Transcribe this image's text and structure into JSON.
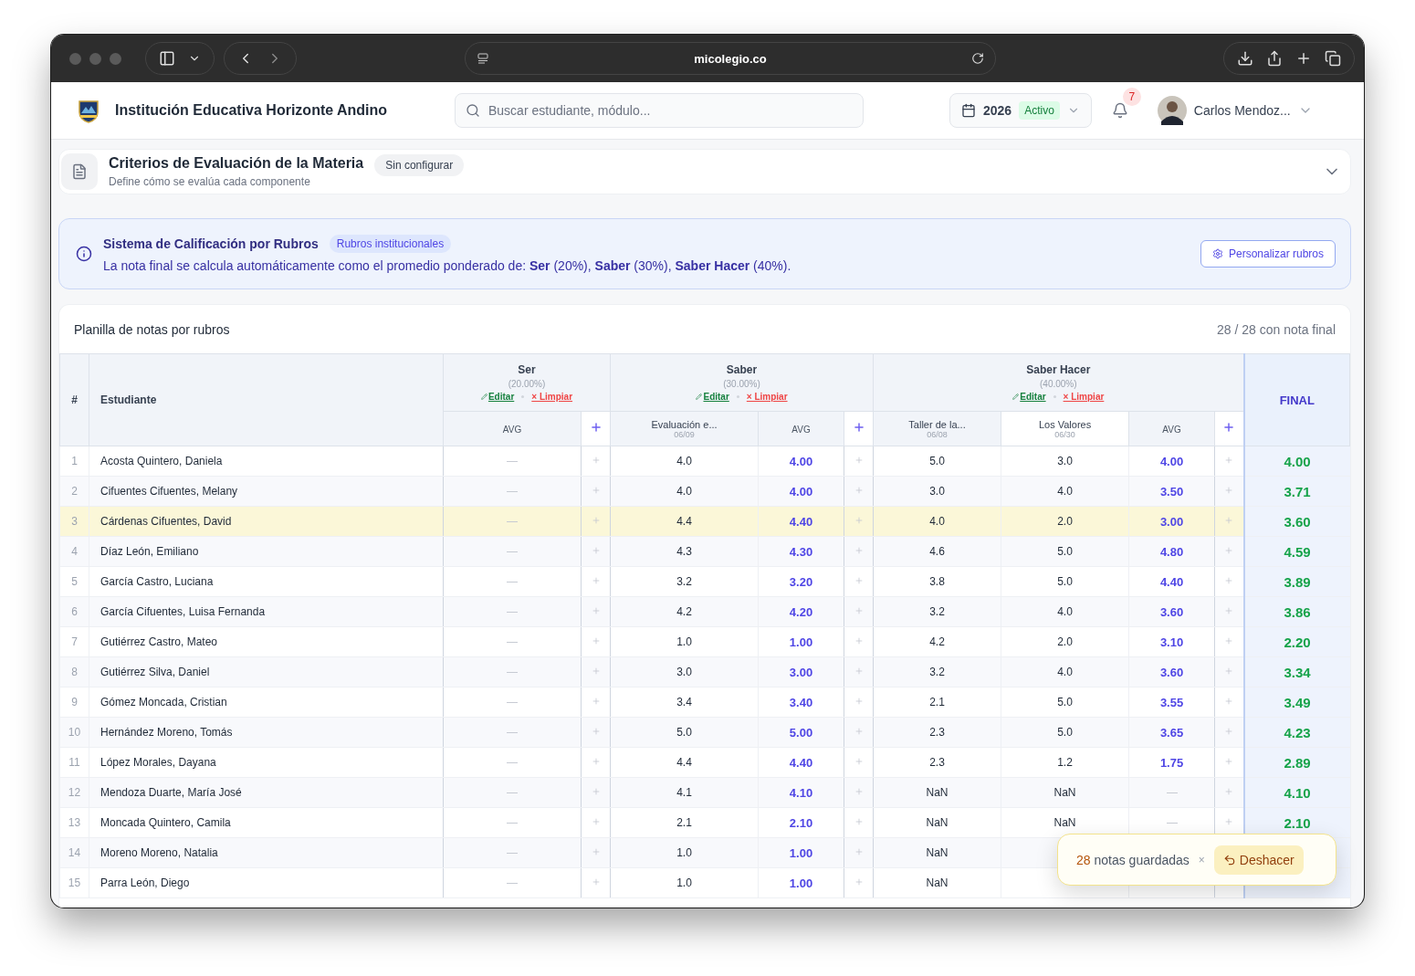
{
  "browser": {
    "address": "micolegio.co"
  },
  "header": {
    "school": "Institución Educativa Horizonte Andino",
    "search": {
      "placeholder": "Buscar estudiante, módulo..."
    },
    "year": "2026",
    "year_status": "Activo",
    "notifications": "7",
    "user": "Carlos Mendoz..."
  },
  "criteria": {
    "title": "Criterios de Evaluación de la Materia",
    "badge": "Sin configurar",
    "subtitle": "Define cómo se evalúa cada componente",
    "expanded": false
  },
  "info": {
    "title": "Sistema de Calificación por Rubros",
    "badge": "Rubros institucionales",
    "text": "La nota final se calcula automáticamente como el promedio ponderado de: **Ser** (20%), **Saber** (30%), **Saber Hacer** (40%).",
    "button": "Personalizar rubros"
  },
  "sheet": {
    "title": "Planilla de notas por rubros",
    "summary": "28 / 28 con nota final",
    "num_header": "#",
    "student_header": "Estudiante",
    "final_header": "FINAL",
    "groups": [
      {
        "name": "Ser",
        "weight": "(20.00%)",
        "edit": "Editar",
        "clear": "× Limpiar",
        "columns": [
          {
            "kind": "avg",
            "label": "AVG"
          }
        ]
      },
      {
        "name": "Saber",
        "weight": "(30.00%)",
        "edit": "Editar",
        "clear": "× Limpiar",
        "columns": [
          {
            "kind": "grade",
            "label": "Evaluación e...",
            "date": "06/09"
          },
          {
            "kind": "avg",
            "label": "AVG"
          }
        ]
      },
      {
        "name": "Saber Hacer",
        "weight": "(40.00%)",
        "edit": "Editar",
        "clear": "× Limpiar",
        "columns": [
          {
            "kind": "grade",
            "label": "Taller de la...",
            "date": "06/08"
          },
          {
            "kind": "grade",
            "label": "Los Valores",
            "date": "06/30"
          },
          {
            "kind": "avg",
            "label": "AVG"
          }
        ]
      }
    ],
    "rows": [
      {
        "num": "1",
        "name": "Acosta Quintero, Daniela",
        "selected": false,
        "cells": [
          null,
          "4.0",
          "4.00",
          "5.0",
          "3.0",
          "4.00"
        ],
        "final": "4.00"
      },
      {
        "num": "2",
        "name": "Cifuentes Cifuentes, Melany",
        "selected": false,
        "cells": [
          null,
          "4.0",
          "4.00",
          "3.0",
          "4.0",
          "3.50"
        ],
        "final": "3.71"
      },
      {
        "num": "3",
        "name": "Cárdenas Cifuentes, David",
        "selected": true,
        "cells": [
          null,
          "4.4",
          "4.40",
          "4.0",
          "2.0",
          "3.00"
        ],
        "final": "3.60"
      },
      {
        "num": "4",
        "name": "Díaz León, Emiliano",
        "selected": false,
        "cells": [
          null,
          "4.3",
          "4.30",
          "4.6",
          "5.0",
          "4.80"
        ],
        "final": "4.59"
      },
      {
        "num": "5",
        "name": "García Castro, Luciana",
        "selected": false,
        "cells": [
          null,
          "3.2",
          "3.20",
          "3.8",
          "5.0",
          "4.40"
        ],
        "final": "3.89"
      },
      {
        "num": "6",
        "name": "García Cifuentes, Luisa Fernanda",
        "selected": false,
        "cells": [
          null,
          "4.2",
          "4.20",
          "3.2",
          "4.0",
          "3.60"
        ],
        "final": "3.86"
      },
      {
        "num": "7",
        "name": "Gutiérrez Castro, Mateo",
        "selected": false,
        "cells": [
          null,
          "1.0",
          "1.00",
          "4.2",
          "2.0",
          "3.10"
        ],
        "final": "2.20"
      },
      {
        "num": "8",
        "name": "Gutiérrez Silva, Daniel",
        "selected": false,
        "cells": [
          null,
          "3.0",
          "3.00",
          "3.2",
          "4.0",
          "3.60"
        ],
        "final": "3.34"
      },
      {
        "num": "9",
        "name": "Gómez Moncada, Cristian",
        "selected": false,
        "cells": [
          null,
          "3.4",
          "3.40",
          "2.1",
          "5.0",
          "3.55"
        ],
        "final": "3.49"
      },
      {
        "num": "10",
        "name": "Hernández Moreno, Tomás",
        "selected": false,
        "cells": [
          null,
          "5.0",
          "5.00",
          "2.3",
          "5.0",
          "3.65"
        ],
        "final": "4.23"
      },
      {
        "num": "11",
        "name": "López Morales, Dayana",
        "selected": false,
        "cells": [
          null,
          "4.4",
          "4.40",
          "2.3",
          "1.2",
          "1.75"
        ],
        "final": "2.89"
      },
      {
        "num": "12",
        "name": "Mendoza Duarte, María José",
        "selected": false,
        "cells": [
          null,
          "4.1",
          "4.10",
          "NaN",
          "NaN",
          null
        ],
        "final": "4.10"
      },
      {
        "num": "13",
        "name": "Moncada Quintero, Camila",
        "selected": false,
        "cells": [
          null,
          "2.1",
          "2.10",
          "NaN",
          "NaN",
          null
        ],
        "final": "2.10"
      },
      {
        "num": "14",
        "name": "Moreno Moreno, Natalia",
        "selected": false,
        "cells": [
          null,
          "1.0",
          "1.00",
          "NaN"
        ]
      },
      {
        "num": "15",
        "name": "Parra León, Diego",
        "selected": false,
        "cells": [
          null,
          "1.0",
          "1.00",
          "NaN"
        ]
      }
    ]
  },
  "toast": {
    "count": "28",
    "text": "notas guardadas",
    "close": "×",
    "button": "Deshacer"
  }
}
